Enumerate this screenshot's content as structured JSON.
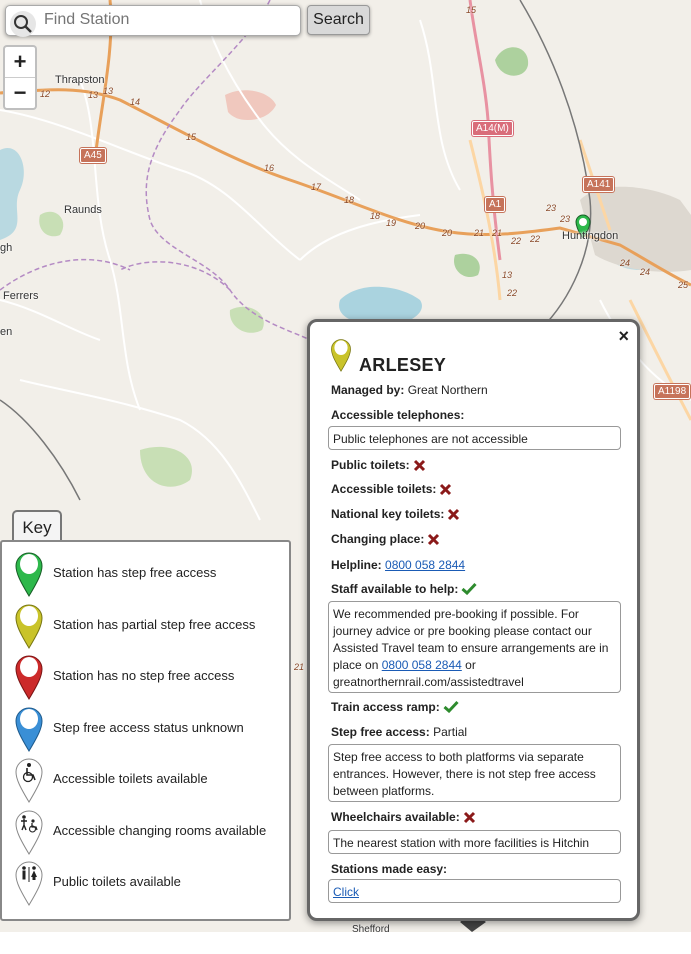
{
  "search": {
    "placeholder": "Find Station",
    "button_label": "Search"
  },
  "zoom": {
    "in_label": "+",
    "out_label": "−"
  },
  "map_labels": {
    "thrapston": "Thrapston",
    "raunds": "Raunds",
    "ferrers": "Ferrers",
    "huntingdon": "Huntingdon",
    "gh": "gh",
    "en": "en",
    "shefford": "Shefford"
  },
  "road_shields": {
    "a45": "A45",
    "a14m": "A14(M)",
    "a1": "A1",
    "a141": "A141",
    "a1198": "A1198"
  },
  "road_numbers": [
    "12",
    "13",
    "13",
    "14",
    "15",
    "16",
    "17",
    "18",
    "18",
    "19",
    "20",
    "20",
    "21",
    "21",
    "22",
    "22",
    "23",
    "23",
    "24",
    "24",
    "25",
    "13",
    "22",
    "15",
    "21"
  ],
  "key": {
    "tab_label": "Key",
    "items": [
      {
        "icon": "green-pin-icon",
        "label": "Station has step free access",
        "color": "#2db84b"
      },
      {
        "icon": "yellow-pin-icon",
        "label": "Station has partial step free access",
        "color": "#c9c32a"
      },
      {
        "icon": "red-pin-icon",
        "label": "Station has no step free access",
        "color": "#cc2a2a"
      },
      {
        "icon": "blue-pin-icon",
        "label": "Step free access status unknown",
        "color": "#3a8fd6"
      },
      {
        "icon": "accessible-toilet-icon",
        "label": "Accessible toilets available"
      },
      {
        "icon": "changing-room-icon",
        "label": "Accessible changing rooms available"
      },
      {
        "icon": "public-toilet-icon",
        "label": "Public toilets available"
      }
    ]
  },
  "popup": {
    "close_label": "×",
    "station_name": "ARLESEY",
    "managed_by_label": "Managed by:",
    "managed_by_value": "Great Northern",
    "accessible_telephones_label": "Accessible telephones:",
    "accessible_telephones_value": "Public telephones are not accessible",
    "public_toilets_label": "Public toilets:",
    "accessible_toilets_label": "Accessible toilets:",
    "national_key_toilets_label": "National key toilets:",
    "changing_place_label": "Changing place:",
    "helpline_label": "Helpline:",
    "helpline_value": "0800 058 2844",
    "staff_label": "Staff available to help:",
    "staff_text_1": "We recommended pre-booking if possible. For journey advice or pre booking please contact our Assisted Travel team to ensure arrangements are in place on",
    "staff_phone": "0800 058 2844",
    "staff_text_2": "or greatnorthernrail.com/assistedtravel",
    "train_ramp_label": "Train access ramp:",
    "step_free_label": "Step free access:",
    "step_free_value": "Partial",
    "step_free_detail": "Step free access to both platforms via separate entrances. However, there is not step free access between platforms.",
    "wheelchairs_label": "Wheelchairs available:",
    "nearest_station_text": "The nearest station with more facilities is Hitchin",
    "stations_made_easy_label": "Stations made easy:",
    "stations_made_easy_link": "Click"
  },
  "colors": {
    "yes": "#2e8b2e",
    "no": "#8b1a1a",
    "pin_partial": "#c9c32a",
    "pin_step_free": "#2db84b",
    "link": "#1a5bb5"
  }
}
